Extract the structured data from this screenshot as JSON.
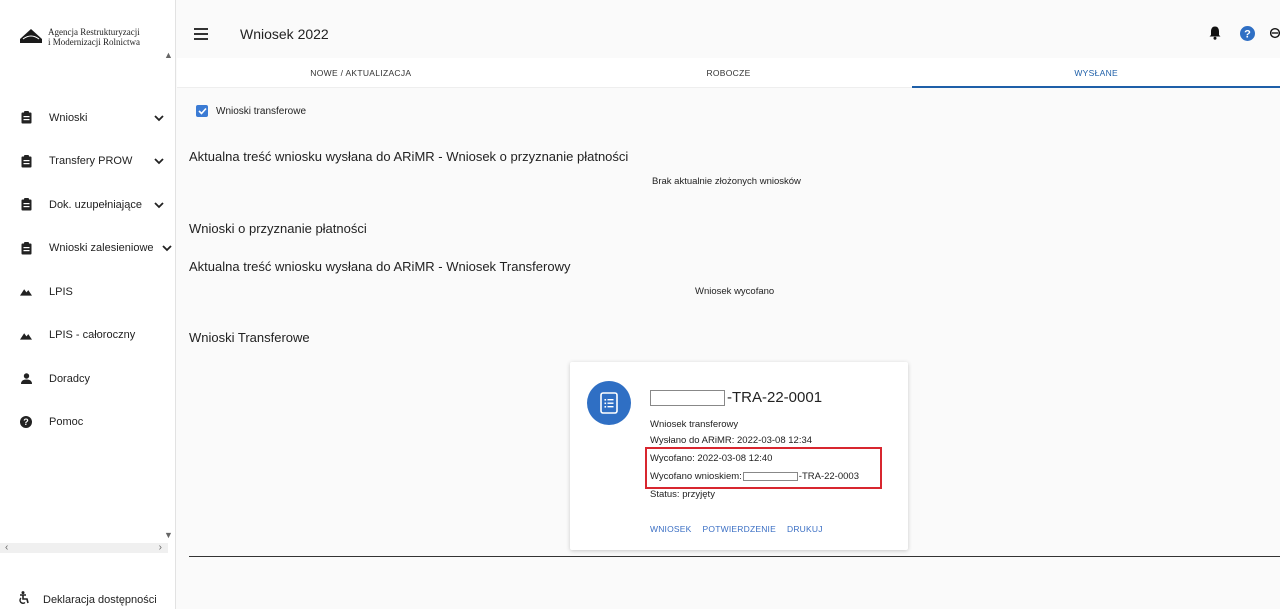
{
  "sidebar": {
    "logo_line1": "Agencja Restrukturyzacji",
    "logo_line2": "i Modernizacji Rolnictwa",
    "items": [
      {
        "label": "Wnioski",
        "icon": "clipboard-icon",
        "has_chevron": true
      },
      {
        "label": "Transfery PROW",
        "icon": "clipboard-icon",
        "has_chevron": true
      },
      {
        "label": "Dok. uzupełniające",
        "icon": "clipboard-icon",
        "has_chevron": true
      },
      {
        "label": "Wnioski zalesieniowe",
        "icon": "clipboard-icon",
        "has_chevron": true
      },
      {
        "label": "LPIS",
        "icon": "terrain-icon",
        "has_chevron": false
      },
      {
        "label": "LPIS - całoroczny",
        "icon": "terrain-icon",
        "has_chevron": false
      },
      {
        "label": "Doradcy",
        "icon": "person-icon",
        "has_chevron": false
      },
      {
        "label": "Pomoc",
        "icon": "help-icon",
        "has_chevron": false
      }
    ],
    "accessibility_label": "Deklaracja dostępności"
  },
  "header": {
    "title": "Wniosek 2022"
  },
  "tabs": [
    {
      "label": "NOWE / AKTUALIZACJA",
      "active": false
    },
    {
      "label": "ROBOCZE",
      "active": false
    },
    {
      "label": "WYSŁANE",
      "active": true
    }
  ],
  "main": {
    "checkbox_label": "Wnioski transferowe",
    "checkbox_checked": true,
    "section1_title": "Aktualna treść wniosku wysłana do ARiMR - Wniosek o przyznanie płatności",
    "section1_note": "Brak aktualnie złożonych wniosków",
    "section2_title": "Wnioski o przyznanie płatności",
    "section3_title": "Aktualna treść wniosku wysłana do ARiMR - Wniosek Transferowy",
    "section3_note": "Wniosek wycofano",
    "section4_title": "Wnioski Transferowe"
  },
  "card": {
    "title_suffix": "-TRA-22-0001",
    "type": "Wniosek transferowy",
    "sent": "Wysłano do ARiMR: 2022-03-08 12:34",
    "withdrawn": "Wycofano: 2022-03-08 12:40",
    "withdrawn_by_prefix": "Wycofano wnioskiem:",
    "withdrawn_by_suffix": "-TRA-22-0003",
    "status": "Status: przyjęty",
    "actions": [
      "WNIOSEK",
      "POTWIERDZENIE",
      "DRUKUJ"
    ]
  },
  "colors": {
    "accent": "#1e5fa8",
    "avatar": "#2f6fc4",
    "highlight": "#d8262f"
  }
}
